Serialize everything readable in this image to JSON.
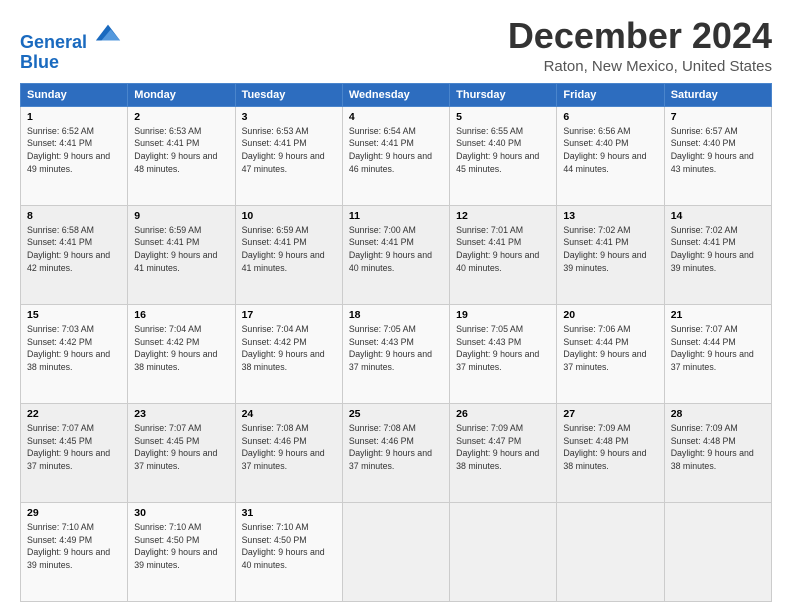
{
  "header": {
    "logo_line1": "General",
    "logo_line2": "Blue",
    "title": "December 2024",
    "subtitle": "Raton, New Mexico, United States"
  },
  "columns": [
    "Sunday",
    "Monday",
    "Tuesday",
    "Wednesday",
    "Thursday",
    "Friday",
    "Saturday"
  ],
  "weeks": [
    [
      {
        "day": "1",
        "sunrise": "6:52 AM",
        "sunset": "4:41 PM",
        "daylight": "9 hours and 49 minutes."
      },
      {
        "day": "2",
        "sunrise": "6:53 AM",
        "sunset": "4:41 PM",
        "daylight": "9 hours and 48 minutes."
      },
      {
        "day": "3",
        "sunrise": "6:53 AM",
        "sunset": "4:41 PM",
        "daylight": "9 hours and 47 minutes."
      },
      {
        "day": "4",
        "sunrise": "6:54 AM",
        "sunset": "4:41 PM",
        "daylight": "9 hours and 46 minutes."
      },
      {
        "day": "5",
        "sunrise": "6:55 AM",
        "sunset": "4:40 PM",
        "daylight": "9 hours and 45 minutes."
      },
      {
        "day": "6",
        "sunrise": "6:56 AM",
        "sunset": "4:40 PM",
        "daylight": "9 hours and 44 minutes."
      },
      {
        "day": "7",
        "sunrise": "6:57 AM",
        "sunset": "4:40 PM",
        "daylight": "9 hours and 43 minutes."
      }
    ],
    [
      {
        "day": "8",
        "sunrise": "6:58 AM",
        "sunset": "4:41 PM",
        "daylight": "9 hours and 42 minutes."
      },
      {
        "day": "9",
        "sunrise": "6:59 AM",
        "sunset": "4:41 PM",
        "daylight": "9 hours and 41 minutes."
      },
      {
        "day": "10",
        "sunrise": "6:59 AM",
        "sunset": "4:41 PM",
        "daylight": "9 hours and 41 minutes."
      },
      {
        "day": "11",
        "sunrise": "7:00 AM",
        "sunset": "4:41 PM",
        "daylight": "9 hours and 40 minutes."
      },
      {
        "day": "12",
        "sunrise": "7:01 AM",
        "sunset": "4:41 PM",
        "daylight": "9 hours and 40 minutes."
      },
      {
        "day": "13",
        "sunrise": "7:02 AM",
        "sunset": "4:41 PM",
        "daylight": "9 hours and 39 minutes."
      },
      {
        "day": "14",
        "sunrise": "7:02 AM",
        "sunset": "4:41 PM",
        "daylight": "9 hours and 39 minutes."
      }
    ],
    [
      {
        "day": "15",
        "sunrise": "7:03 AM",
        "sunset": "4:42 PM",
        "daylight": "9 hours and 38 minutes."
      },
      {
        "day": "16",
        "sunrise": "7:04 AM",
        "sunset": "4:42 PM",
        "daylight": "9 hours and 38 minutes."
      },
      {
        "day": "17",
        "sunrise": "7:04 AM",
        "sunset": "4:42 PM",
        "daylight": "9 hours and 38 minutes."
      },
      {
        "day": "18",
        "sunrise": "7:05 AM",
        "sunset": "4:43 PM",
        "daylight": "9 hours and 37 minutes."
      },
      {
        "day": "19",
        "sunrise": "7:05 AM",
        "sunset": "4:43 PM",
        "daylight": "9 hours and 37 minutes."
      },
      {
        "day": "20",
        "sunrise": "7:06 AM",
        "sunset": "4:44 PM",
        "daylight": "9 hours and 37 minutes."
      },
      {
        "day": "21",
        "sunrise": "7:07 AM",
        "sunset": "4:44 PM",
        "daylight": "9 hours and 37 minutes."
      }
    ],
    [
      {
        "day": "22",
        "sunrise": "7:07 AM",
        "sunset": "4:45 PM",
        "daylight": "9 hours and 37 minutes."
      },
      {
        "day": "23",
        "sunrise": "7:07 AM",
        "sunset": "4:45 PM",
        "daylight": "9 hours and 37 minutes."
      },
      {
        "day": "24",
        "sunrise": "7:08 AM",
        "sunset": "4:46 PM",
        "daylight": "9 hours and 37 minutes."
      },
      {
        "day": "25",
        "sunrise": "7:08 AM",
        "sunset": "4:46 PM",
        "daylight": "9 hours and 37 minutes."
      },
      {
        "day": "26",
        "sunrise": "7:09 AM",
        "sunset": "4:47 PM",
        "daylight": "9 hours and 38 minutes."
      },
      {
        "day": "27",
        "sunrise": "7:09 AM",
        "sunset": "4:48 PM",
        "daylight": "9 hours and 38 minutes."
      },
      {
        "day": "28",
        "sunrise": "7:09 AM",
        "sunset": "4:48 PM",
        "daylight": "9 hours and 38 minutes."
      }
    ],
    [
      {
        "day": "29",
        "sunrise": "7:10 AM",
        "sunset": "4:49 PM",
        "daylight": "9 hours and 39 minutes."
      },
      {
        "day": "30",
        "sunrise": "7:10 AM",
        "sunset": "4:50 PM",
        "daylight": "9 hours and 39 minutes."
      },
      {
        "day": "31",
        "sunrise": "7:10 AM",
        "sunset": "4:50 PM",
        "daylight": "9 hours and 40 minutes."
      },
      null,
      null,
      null,
      null
    ]
  ]
}
